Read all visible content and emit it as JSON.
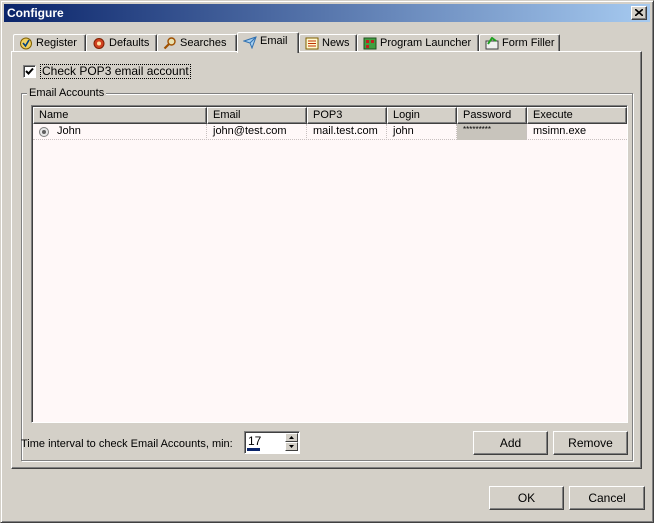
{
  "window": {
    "title": "Configure"
  },
  "tabs": [
    {
      "label": "Register",
      "icon": "register-icon"
    },
    {
      "label": "Defaults",
      "icon": "defaults-icon"
    },
    {
      "label": "Searches",
      "icon": "search-icon"
    },
    {
      "label": "Email",
      "icon": "email-icon",
      "active": true
    },
    {
      "label": "News",
      "icon": "news-icon"
    },
    {
      "label": "Program Launcher",
      "icon": "program-launcher-icon"
    },
    {
      "label": "Form Filler",
      "icon": "form-filler-icon"
    }
  ],
  "email_tab": {
    "check_pop3_label": "Check POP3 email account",
    "check_pop3_checked": true,
    "group_title": "Email Accounts",
    "columns": [
      "Name",
      "Email",
      "POP3",
      "Login",
      "Password",
      "Execute"
    ],
    "rows": [
      {
        "name": "John",
        "email": "john@test.com",
        "pop3": "mail.test.com",
        "login": "john",
        "password": "*********",
        "execute": "msimn.exe"
      }
    ],
    "interval_label": "Time interval to check Email Accounts, min:",
    "interval_value": "17",
    "interval_progress_fraction": 0.35,
    "add_label": "Add",
    "remove_label": "Remove"
  },
  "footer": {
    "ok_label": "OK",
    "cancel_label": "Cancel"
  },
  "colors": {
    "title_start": "#0a246a",
    "title_end": "#a6caf0",
    "face": "#d4d0c8",
    "list_bg": "#fff8f8"
  }
}
